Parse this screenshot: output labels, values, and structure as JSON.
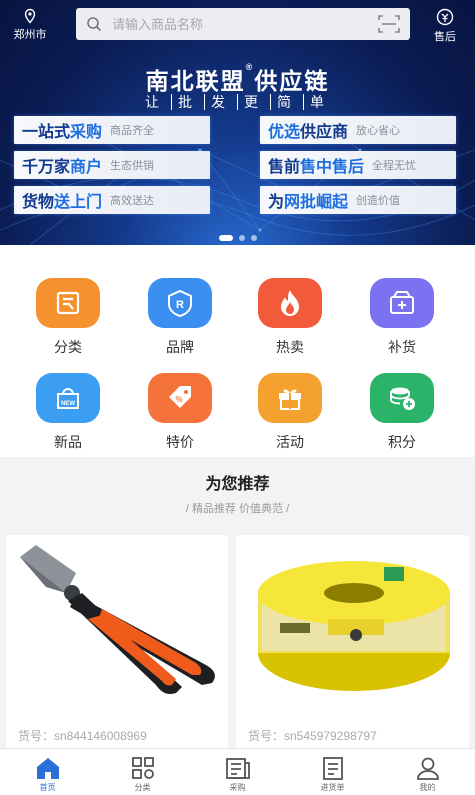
{
  "header": {
    "city": "郑州市",
    "search_placeholder": "请输入商品名称",
    "aftersale_label": "售后"
  },
  "banner": {
    "title": "南北联盟",
    "title_mark": "®",
    "title_tail": "供应链",
    "slogan": [
      "让",
      "批",
      "发",
      "更",
      "简",
      "单"
    ],
    "left_cards": [
      {
        "main_a": "一站式",
        "main_b": "采购",
        "sub": "商品齐全"
      },
      {
        "main_a": "千万家",
        "main_b": "商户",
        "sub": "生态供销"
      },
      {
        "main_a": "货物",
        "main_b": "送上门",
        "sub": "高效送达"
      }
    ],
    "right_cards": [
      {
        "main_a": "优选",
        "main_b": "供应商",
        "sub": "放心省心"
      },
      {
        "main_a": "售前",
        "main_b": "售中售后",
        "sub": "全程无忧"
      },
      {
        "main_a": "为",
        "main_b": "网批崛起",
        "sub": "创造价值"
      }
    ]
  },
  "categories": [
    {
      "label": "分类",
      "color": "#f5922f",
      "icon": "category-icon"
    },
    {
      "label": "品牌",
      "color": "#3b8ff0",
      "icon": "brand-icon"
    },
    {
      "label": "热卖",
      "color": "#f15a3b",
      "icon": "fire-icon"
    },
    {
      "label": "补货",
      "color": "#7a72f0",
      "icon": "restock-icon"
    },
    {
      "label": "新品",
      "color": "#3b9ef2",
      "icon": "new-icon"
    },
    {
      "label": "特价",
      "color": "#f5733a",
      "icon": "discount-tag-icon"
    },
    {
      "label": "活动",
      "color": "#f5a12f",
      "icon": "gift-icon"
    },
    {
      "label": "积分",
      "color": "#2bb36a",
      "icon": "coins-icon"
    }
  ],
  "recommend": {
    "title": "为您推荐",
    "subtitle": "/ 精品推荐 价值典范 /",
    "products": [
      {
        "sku": "货号：sn844146008969"
      },
      {
        "sku": "货号：sn545979298797"
      }
    ]
  },
  "tabbar": [
    {
      "label": "首页",
      "icon": "home-icon",
      "active": true
    },
    {
      "label": "分类",
      "icon": "grid-icon"
    },
    {
      "label": "采购",
      "icon": "news-icon"
    },
    {
      "label": "进货单",
      "icon": "order-list-icon"
    },
    {
      "label": "我的",
      "icon": "user-icon"
    }
  ],
  "colors": {
    "accent": "#2a6fd8",
    "banner_dark": "#0b1d55"
  }
}
